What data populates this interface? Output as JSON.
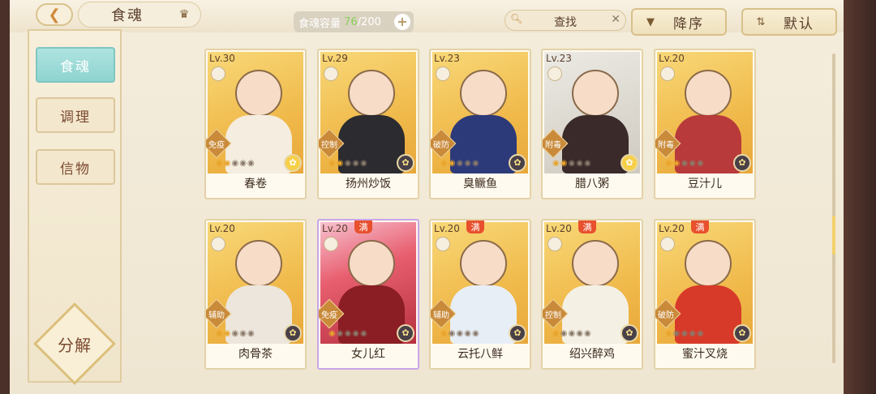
{
  "header": {
    "tab_title": "食魂",
    "capacity_label": "食魂容量",
    "capacity_current": "76",
    "capacity_max": "/200",
    "search_label": "查找",
    "sort_desc_label": "降序",
    "sort_default_label": "默认"
  },
  "sidebar": {
    "items": [
      {
        "label": "食魂",
        "active": true
      },
      {
        "label": "调理",
        "active": false
      },
      {
        "label": "信物",
        "active": false
      }
    ],
    "decompose_label": "分解"
  },
  "cards": [
    {
      "level": "Lv.30",
      "name": "春卷",
      "tag": "免疫",
      "stars_on": 2,
      "stars_total": 5,
      "full": false,
      "style": "gold",
      "badge": "gold"
    },
    {
      "level": "Lv.29",
      "name": "扬州炒饭",
      "tag": "控制",
      "stars_on": 2,
      "stars_total": 5,
      "full": false,
      "style": "gold",
      "badge": "dark"
    },
    {
      "level": "Lv.23",
      "name": "臭鳜鱼",
      "tag": "破防",
      "stars_on": 2,
      "stars_total": 5,
      "full": false,
      "style": "gold",
      "badge": "dark"
    },
    {
      "level": "Lv.23",
      "name": "腊八粥",
      "tag": "附毒",
      "stars_on": 2,
      "stars_total": 5,
      "full": false,
      "style": "silver",
      "badge": "gold"
    },
    {
      "level": "Lv.20",
      "name": "豆汁儿",
      "tag": "附毒",
      "stars_on": 2,
      "stars_total": 5,
      "full": false,
      "style": "gold",
      "badge": "dark"
    },
    {
      "level": "Lv.20",
      "name": "肉骨茶",
      "tag": "辅助",
      "stars_on": 2,
      "stars_total": 5,
      "full": false,
      "style": "gold",
      "badge": "dark"
    },
    {
      "level": "Lv.20",
      "name": "女儿红",
      "tag": "免疫",
      "stars_on": 1,
      "stars_total": 5,
      "full": true,
      "style": "rainbow",
      "badge": "dark"
    },
    {
      "level": "Lv.20",
      "name": "云托八鲜",
      "tag": "辅助",
      "stars_on": 1,
      "stars_total": 5,
      "full": true,
      "style": "gold",
      "badge": "dark"
    },
    {
      "level": "Lv.20",
      "name": "绍兴醉鸡",
      "tag": "控制",
      "stars_on": 1,
      "stars_total": 5,
      "full": true,
      "style": "gold",
      "badge": "dark"
    },
    {
      "level": "Lv.20",
      "name": "蜜汁叉烧",
      "tag": "破防",
      "stars_on": 1,
      "stars_total": 5,
      "full": true,
      "style": "gold",
      "badge": "dark"
    }
  ],
  "card_full_label": "满",
  "colors": {
    "accent_teal": "#8fd4d0",
    "gold": "#f0b94a",
    "frame": "#4a3029"
  }
}
